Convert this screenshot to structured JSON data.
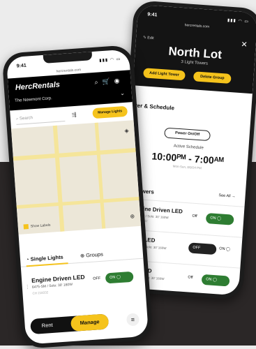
{
  "colors": {
    "accent": "#f5c31c",
    "on": "#2e7d32",
    "dark": "#141414",
    "background_top": "#ececec",
    "background_bottom": "#2b2727"
  },
  "back_phone": {
    "status_time": "9:41",
    "url": "hercrentals.com",
    "edit_label": "Edit",
    "title": "North Lot",
    "subtitle": "3 Light Towers",
    "add_button": "Add Light Tower",
    "delete_button": "Delete Group",
    "section_power": "ver & Schedule",
    "toggle_label": "Power On/Off",
    "active_label": "Active Schedule",
    "time": "10:00ᴾᴹ - 7:00ᴬᴹ",
    "date": "Mon-Sun, 8/9/24 PM",
    "section_towers": "ht Towers",
    "see_all": "See All →",
    "towers": [
      {
        "name": "Engine Driven LED",
        "spec": "6475-SM / Solo: 30' 160W",
        "id": "CH 218332",
        "state": "on",
        "off_label": "Off",
        "on_label": "ON ◯"
      },
      {
        "name": "outh LED",
        "spec": "6475-SM / Solo: 30' 160W",
        "id": "CH 221665",
        "state": "off",
        "off_label": "OFF",
        "on_label": "ON ◯"
      },
      {
        "name": "orth LED",
        "spec": "6475-SM / Solo: 30' 160W",
        "id": "CH 219442",
        "state": "on",
        "off_label": "Off",
        "on_label": "ON ◯"
      }
    ]
  },
  "front_phone": {
    "status_time": "9:41",
    "url": "hercrentals.com",
    "logo": "HercRentals",
    "company": "The Newmont Corp.",
    "search_placeholder": "Search",
    "manage_lights": "Manage Lights",
    "show_labels": "Show Labels",
    "tab_single": "Single Lights",
    "tab_groups": "Groups",
    "item": {
      "name": "Engine Driven LED",
      "spec": "6475-SM / Solo: 30' 160W",
      "id": "CH 218332",
      "off_label": "OFF",
      "on_label": "ON ◯"
    },
    "rent": "Rent",
    "manage": "Manage"
  }
}
